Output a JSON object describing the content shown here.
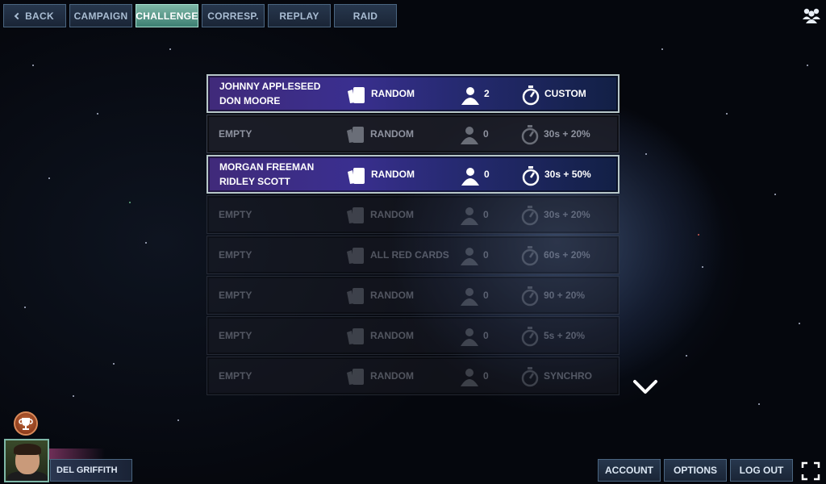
{
  "nav": {
    "back": "BACK",
    "campaign": "CAMPAIGN",
    "challenge": "CHALLENGE",
    "corresp": "CORRESP.",
    "replay": "REPLAY",
    "raid": "RAID"
  },
  "icons": {
    "friends": "friends-icon",
    "deck": "cards-icon",
    "player": "player-icon",
    "timer": "stopwatch-icon",
    "scroll": "chevron-down-icon",
    "trophy": "trophy-icon",
    "fullscreen": "fullscreen-icon"
  },
  "colors": {
    "active_tab": "#5f9e8f",
    "filled_row": "#3a2f8f",
    "empty_text": "#8f93a0"
  },
  "challenges": [
    {
      "name1": "JOHNNY APPLESEED",
      "name2": "DON MOORE",
      "deck": "RANDOM",
      "players": "2",
      "time": "CUSTOM"
    },
    {
      "name1": "EMPTY",
      "name2": "",
      "deck": "RANDOM",
      "players": "0",
      "time": "30s + 20%"
    },
    {
      "name1": "MORGAN FREEMAN",
      "name2": "RIDLEY SCOTT",
      "deck": "RANDOM",
      "players": "0",
      "time": "30s + 50%"
    },
    {
      "name1": "EMPTY",
      "name2": "",
      "deck": "RANDOM",
      "players": "0",
      "time": "30s + 20%"
    },
    {
      "name1": "EMPTY",
      "name2": "",
      "deck": "ALL RED CARDS",
      "players": "0",
      "time": "60s + 20%"
    },
    {
      "name1": "EMPTY",
      "name2": "",
      "deck": "RANDOM",
      "players": "0",
      "time": "90 + 20%"
    },
    {
      "name1": "EMPTY",
      "name2": "",
      "deck": "RANDOM",
      "players": "0",
      "time": "5s + 20%"
    },
    {
      "name1": "EMPTY",
      "name2": "",
      "deck": "RANDOM",
      "players": "0",
      "time": "SYNCHRO"
    }
  ],
  "profile": {
    "name": "DEL GRIFFITH"
  },
  "footer": {
    "account": "ACCOUNT",
    "options": "OPTIONS",
    "logout": "LOG OUT"
  }
}
